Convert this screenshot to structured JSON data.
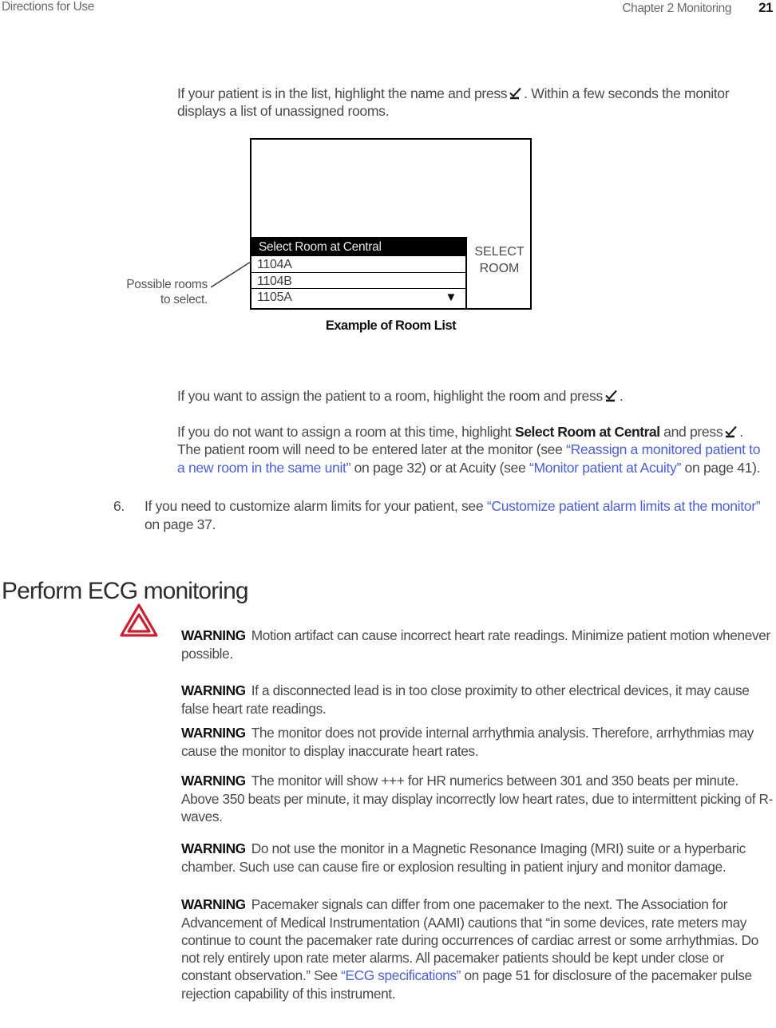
{
  "header": {
    "left": "Directions for Use",
    "chapter": "Chapter 2   Monitoring",
    "page_number": "21"
  },
  "colors": {
    "link": "#4a5fe0",
    "warning_red": "#CC2031",
    "highlight_bar_bg": "#000000",
    "highlight_bar_text": "#e8e8e8",
    "body_text": "#4a4a4a"
  },
  "paragraphs": {
    "intro_a": "If your patient is in the list, highlight the name and press",
    "intro_b": ". Within a few seconds the monitor displays a list of unassigned rooms.",
    "assign_a": "If you want to assign the patient to a room, highlight the room and press",
    "assign_b": ".",
    "central_a": "If you do not want to assign a room at this time, highlight ",
    "central_bold": "Select Room at Central",
    "central_b": " and press",
    "central_c": ". The patient room will need to be entered later at the monitor (see ",
    "central_link1": "“Reassign a monitored patient to a new room in the same unit”",
    "central_d": " on page 32) or at Acuity (see ",
    "central_link2": "“Monitor patient at Acuity”",
    "central_e": " on page 41)."
  },
  "step": {
    "number": "6.",
    "text_a": "If you need to customize alarm limits for your patient, see ",
    "link": "“Customize patient alarm limits at the monitor”",
    "text_b": " on page 37."
  },
  "section": {
    "heading": "Perform ECG monitoring"
  },
  "figure": {
    "caption": "Example of Room List",
    "callout": "Possible rooms to select.",
    "screen": {
      "list_title": "Select Room at Central",
      "rooms": [
        "1104A",
        "1104B",
        "1105A"
      ],
      "scroll_caret": "▼",
      "softkey_line1": "SELECT",
      "softkey_line2": "ROOM"
    }
  },
  "warnings": [
    {
      "label": "WARNING",
      "text": "Motion artifact can cause incorrect heart rate readings. Minimize patient motion whenever possible."
    },
    {
      "label": "WARNING",
      "text": "If a disconnected lead is in too close proximity to other electrical devices, it may cause false heart rate readings."
    },
    {
      "label": "WARNING",
      "text": "The monitor does not provide internal arrhythmia analysis. Therefore, arrhythmias may cause the monitor to display inaccurate heart rates."
    },
    {
      "label": "WARNING",
      "text": "The monitor will show +++ for HR numerics between 301 and 350 beats per minute. Above 350 beats per minute, it may display incorrectly low heart rates, due to intermittent picking of R-waves."
    },
    {
      "label": "WARNING",
      "text": "Do not use the monitor in a Magnetic Resonance Imaging (MRI) suite or a hyperbaric chamber. Such use can cause fire or explosion resulting in patient injury and monitor damage."
    },
    {
      "label": "WARNING",
      "text_a": "Pacemaker signals can differ from one pacemaker to the next. The Association for Advancement of Medical Instrumentation (AAMI) cautions that “in some devices, rate meters may continue to count the pacemaker rate during occurrences of cardiac arrest or some arrhythmias. Do not rely entirely upon rate meter alarms. All pacemaker patients should be kept under close or constant observation.” See ",
      "link": "“ECG specifications”",
      "text_b": " on page 51 for disclosure of the pacemaker pulse rejection capability of this instrument."
    }
  ]
}
